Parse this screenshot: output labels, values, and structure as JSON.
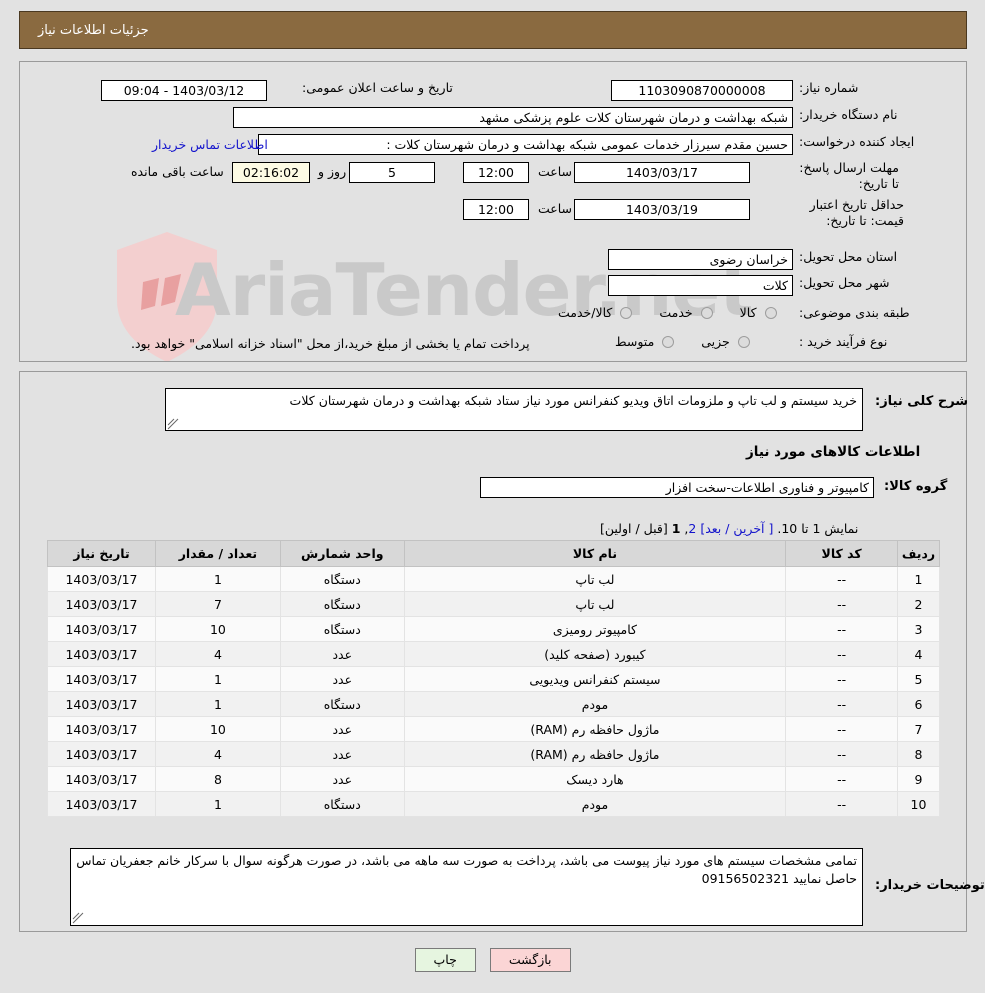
{
  "header": {
    "title": "جزئیات اطلاعات نیاز"
  },
  "watermark": {
    "text": "AriaTender.net",
    "shield_color": "#f0c9c9"
  },
  "top_form": {
    "need_number": {
      "label": "شماره نیاز:",
      "value": "1103090870000008"
    },
    "public_announce": {
      "label": "تاریخ و ساعت اعلان عمومی:",
      "value": "1403/03/12 - 09:04"
    },
    "buyer_org": {
      "label": "نام دستگاه خریدار:",
      "value": "شبکه بهداشت و درمان شهرستان کلات   علوم پزشکی مشهد"
    },
    "requester": {
      "label": "ایجاد کننده درخواست:",
      "value": "حسین مقدم سیرزار خدمات عمومی شبکه بهداشت و درمان شهرستان کلات   :",
      "contact_link": "اطلاعات تماس خریدار"
    },
    "response_deadline": {
      "label": "مهلت ارسال پاسخ: تا تاریخ:",
      "date": "1403/03/17",
      "time_label": "ساعت",
      "time": "12:00"
    },
    "countdown": {
      "days": "5",
      "days_label": "روز و",
      "clock": "02:16:02",
      "remaining_label": "ساعت باقی مانده"
    },
    "price_validity": {
      "label": "حداقل تاریخ اعتبار قیمت: تا تاریخ:",
      "date": "1403/03/19",
      "time_label": "ساعت",
      "time": "12:00"
    },
    "province": {
      "label": "استان محل تحویل:",
      "value": "خراسان رضوی"
    },
    "city": {
      "label": "شهر محل تحویل:",
      "value": "کلات"
    },
    "category": {
      "label": "طبقه بندی موضوعی:",
      "options": [
        "کالا",
        "خدمت",
        "کالا/خدمت"
      ]
    },
    "process_type": {
      "label": "نوع فرآیند خرید :",
      "options": [
        "جزیی",
        "متوسط"
      ],
      "note": "پرداخت تمام یا بخشی از مبلغ خرید،از محل \"اسناد خزانه اسلامی\" خواهد بود."
    }
  },
  "mid": {
    "need_summary": {
      "label": "شرح کلی نیاز:",
      "value": "خرید سیستم و لب تاپ و ملزومات اتاق ویدیو کنفرانس مورد نیاز ستاد شبکه بهداشت و درمان شهرستان کلات"
    },
    "goods_heading": "اطلاعات کالاهای مورد نیاز",
    "goods_group": {
      "label": "گروه کالا:",
      "value": "کامپیوتر و فناوری اطلاعات-سخت افزار"
    },
    "pager": {
      "prefix": "نمایش 1 تا 10.",
      "last_next": "[ آخرین / بعد]",
      "page_2": "2",
      "comma": ",",
      "page_1": "1",
      "prev_first": "[قبل / اولین]"
    },
    "table": {
      "columns": [
        "ردیف",
        "کد کالا",
        "نام کالا",
        "واحد شمارش",
        "تعداد / مقدار",
        "تاریخ نیاز"
      ],
      "rows": [
        {
          "row": "1",
          "code": "--",
          "name": "لب تاپ",
          "unit": "دستگاه",
          "qty": "1",
          "date": "1403/03/17"
        },
        {
          "row": "2",
          "code": "--",
          "name": "لب تاپ",
          "unit": "دستگاه",
          "qty": "7",
          "date": "1403/03/17"
        },
        {
          "row": "3",
          "code": "--",
          "name": "کامپیوتر رومیزی",
          "unit": "دستگاه",
          "qty": "10",
          "date": "1403/03/17"
        },
        {
          "row": "4",
          "code": "--",
          "name": "کیبورد (صفحه کلید)",
          "unit": "عدد",
          "qty": "4",
          "date": "1403/03/17"
        },
        {
          "row": "5",
          "code": "--",
          "name": "سیستم کنفرانس ویدیویی",
          "unit": "عدد",
          "qty": "1",
          "date": "1403/03/17"
        },
        {
          "row": "6",
          "code": "--",
          "name": "مودم",
          "unit": "دستگاه",
          "qty": "1",
          "date": "1403/03/17"
        },
        {
          "row": "7",
          "code": "--",
          "name": "ماژول حافظه رم (RAM)",
          "unit": "عدد",
          "qty": "10",
          "date": "1403/03/17"
        },
        {
          "row": "8",
          "code": "--",
          "name": "ماژول حافظه رم (RAM)",
          "unit": "عدد",
          "qty": "4",
          "date": "1403/03/17"
        },
        {
          "row": "9",
          "code": "--",
          "name": "هارد دیسک",
          "unit": "عدد",
          "qty": "8",
          "date": "1403/03/17"
        },
        {
          "row": "10",
          "code": "--",
          "name": "مودم",
          "unit": "دستگاه",
          "qty": "1",
          "date": "1403/03/17"
        }
      ]
    },
    "buyer_notes": {
      "label": "توضیحات خریدار:",
      "value": "تمامی مشخصات سیستم های مورد نیاز پیوست می باشد، پرداخت به صورت سه ماهه می باشد، در صورت هرگونه سوال با سرکار خانم جعفریان تماس حاصل نمایید 09156502321"
    }
  },
  "footer": {
    "print": "چاپ",
    "back": "بازگشت"
  }
}
